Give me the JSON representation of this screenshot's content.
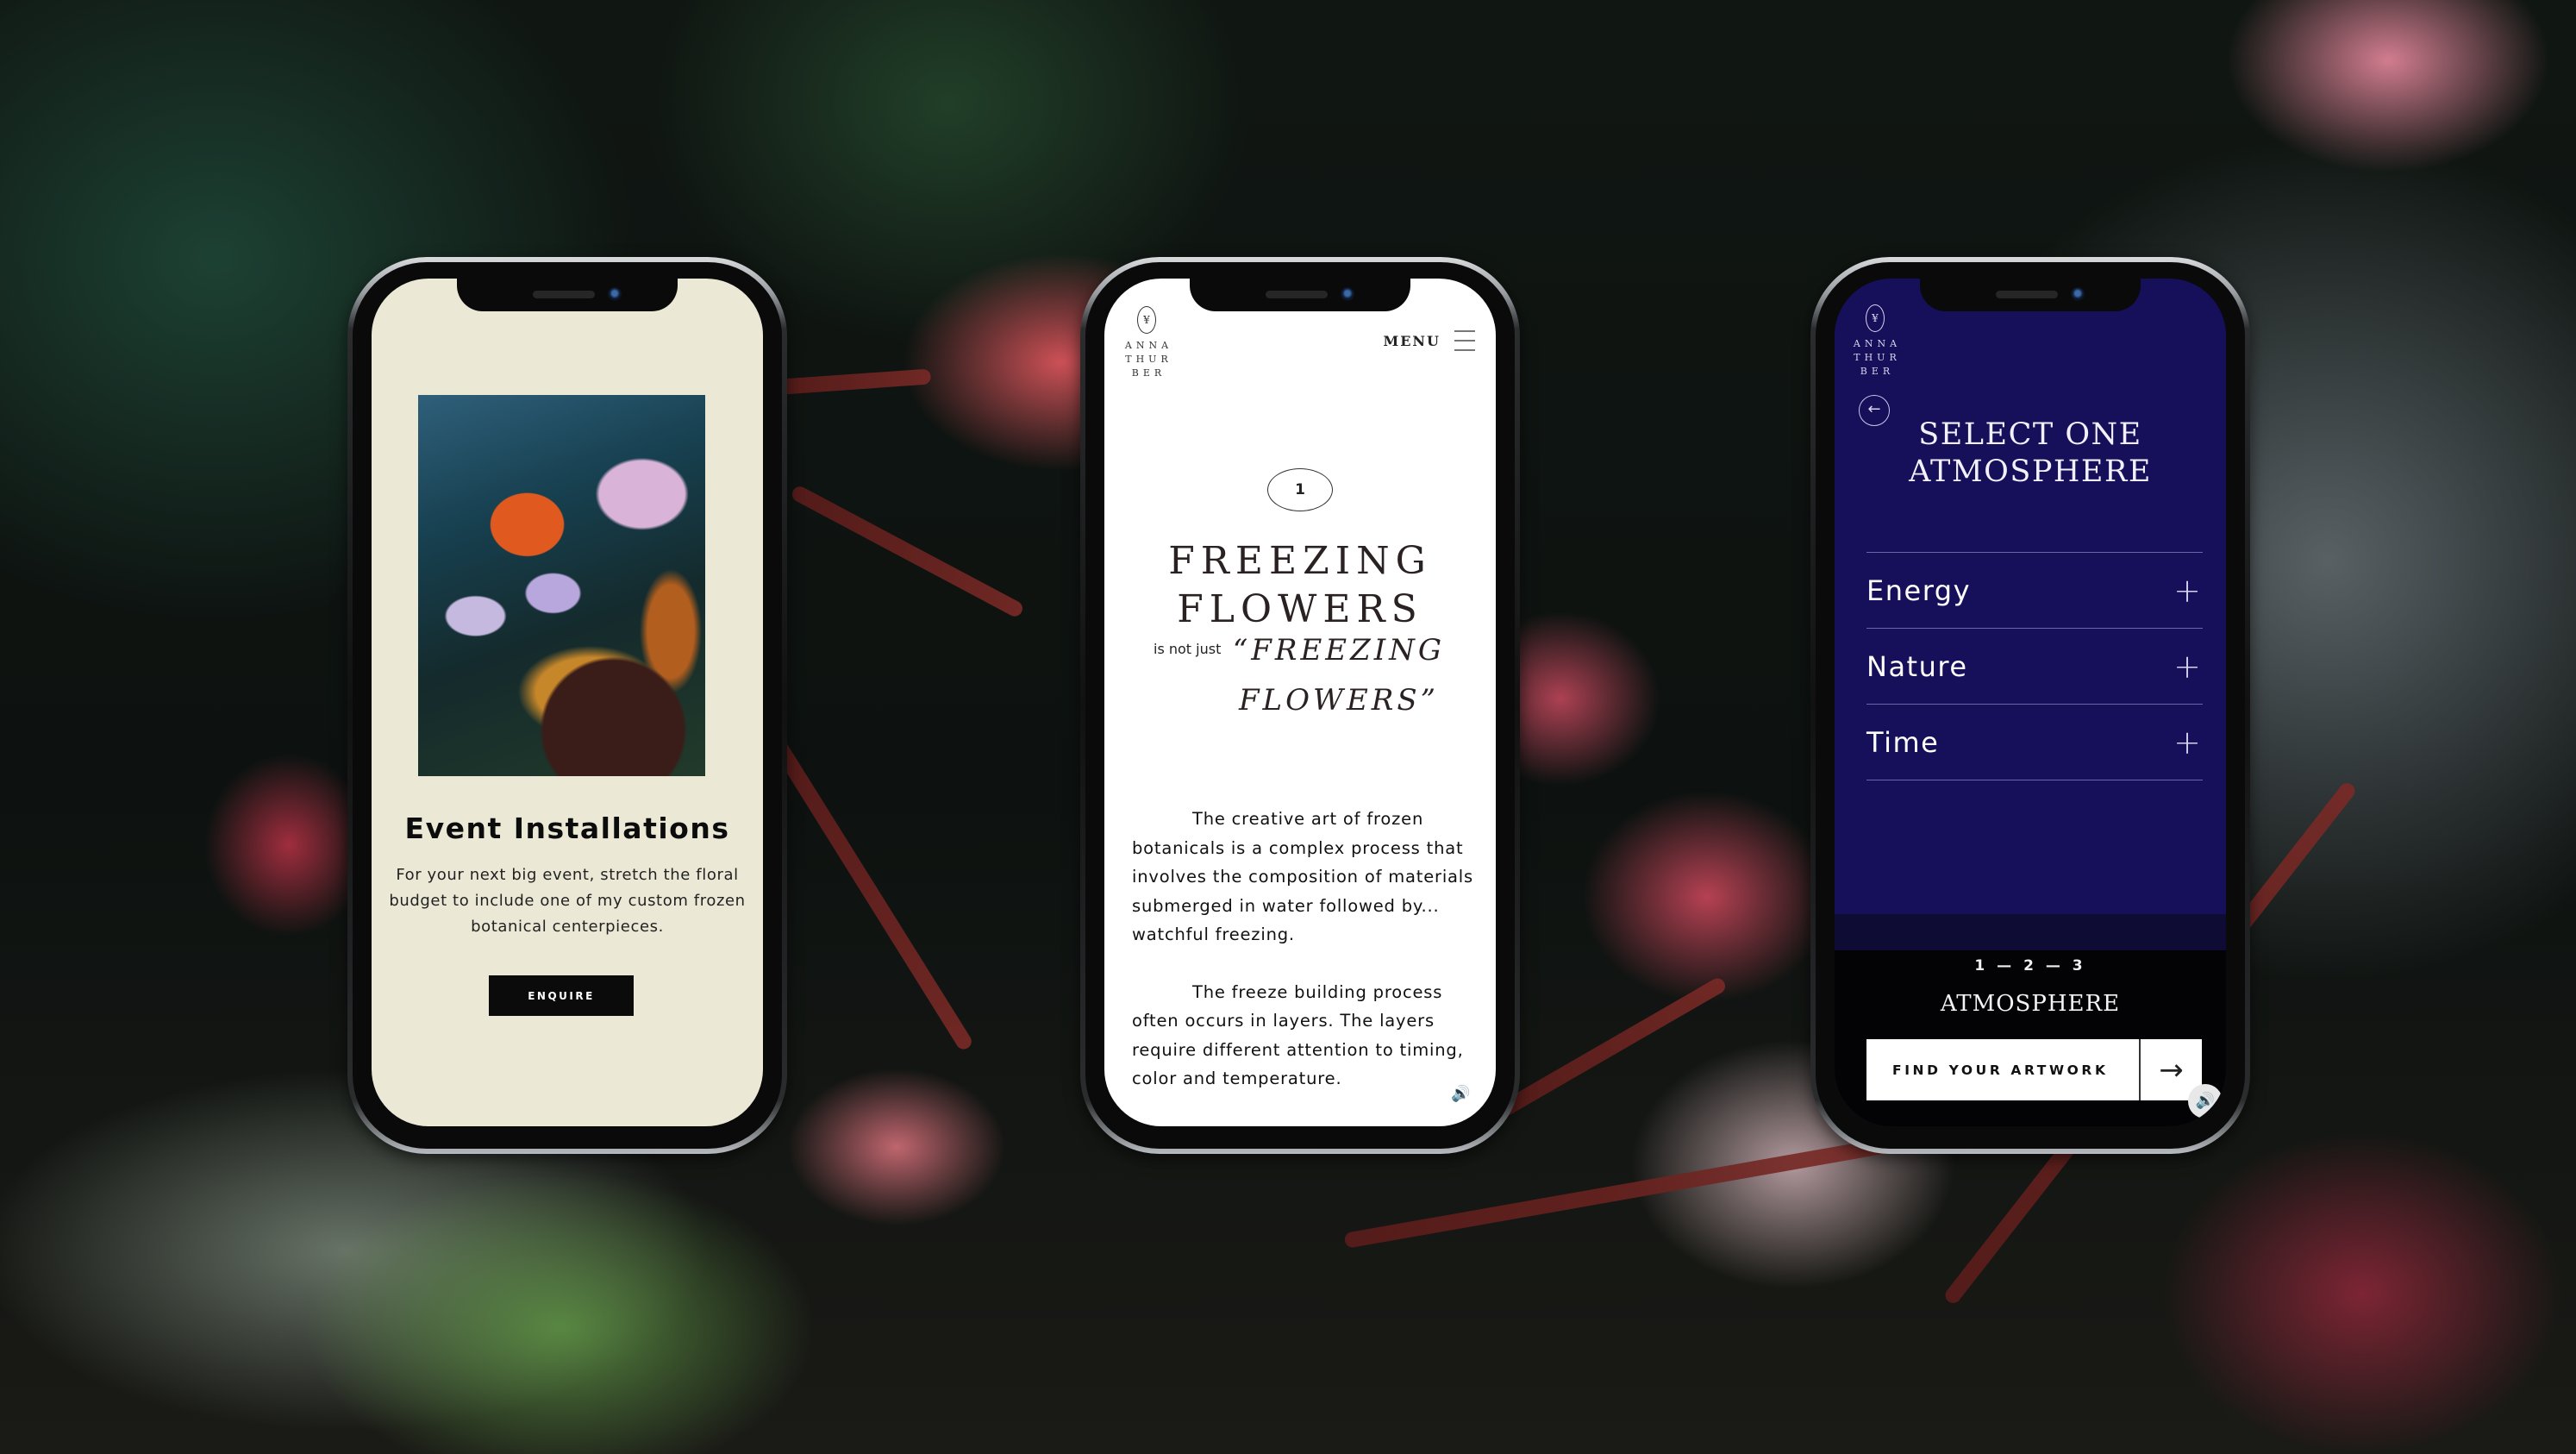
{
  "phones": {
    "event": {
      "image_alt": "frozen flower arrangement photo",
      "title": "Event Installations",
      "description": "For your next big event, stretch the floral budget to include one of my custom frozen botanical centerpieces.",
      "button": "ENQUIRE",
      "background_color": "#ebe9d6"
    },
    "article": {
      "logo_monogram": "¥",
      "logo_lines": [
        "ANNA",
        "THUR",
        "BER"
      ],
      "menu_label": "MENU",
      "step_number": "1",
      "heading_line1": "FREEZING",
      "heading_line2": "FLOWERS",
      "is_not_just": "is not just",
      "quote": "“FREEZING FLOWERS”",
      "paragraphs": [
        "The creative art of frozen botanicals is a complex process that involves the composition of materials  submerged in water followed by... watchful freezing.",
        "The freeze building process often occurs in layers. The layers require different attention to timing, color and temperature."
      ],
      "sound_icon": "🔊"
    },
    "atmosphere": {
      "logo_monogram": "¥",
      "logo_lines": [
        "ANNA",
        "THUR",
        "BER"
      ],
      "back_icon": "←",
      "heading_line1": "SELECT ONE",
      "heading_line2": "ATMOSPHERE",
      "options": [
        {
          "label": "Energy",
          "icon": "+"
        },
        {
          "label": "Nature",
          "icon": "+"
        },
        {
          "label": "Time",
          "icon": "+"
        }
      ],
      "steps": "1 — 2 — 3",
      "current_step_label": "ATMOSPHERE",
      "cta_label": "FIND YOUR ARTWORK",
      "cta_arrow": "→",
      "sound_icon": "🔊",
      "background_color": "#160f5a"
    }
  }
}
